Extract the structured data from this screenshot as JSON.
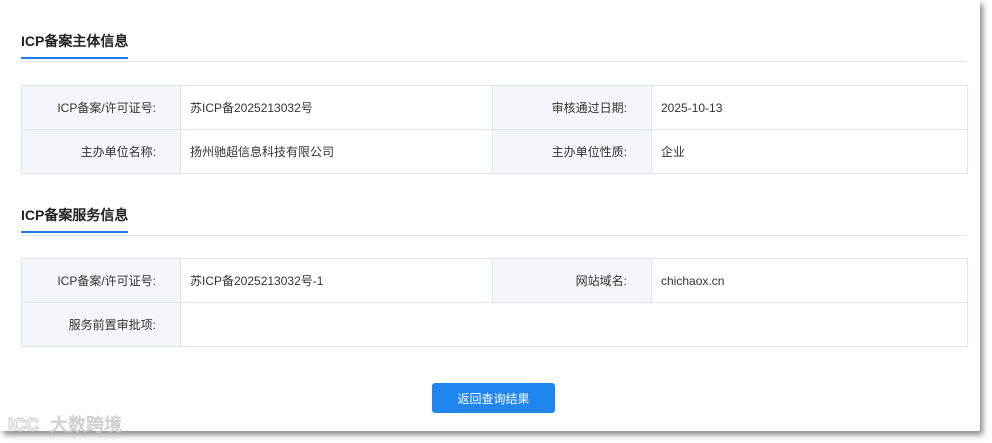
{
  "subject_section": {
    "title": "ICP备案主体信息",
    "rows": [
      {
        "label1": "ICP备案/许可证号:",
        "value1": "苏ICP备2025213032号",
        "label2": "审核通过日期:",
        "value2": "2025-10-13"
      },
      {
        "label1": "主办单位名称:",
        "value1": "扬州驰超信息科技有限公司",
        "label2": "主办单位性质:",
        "value2": "企业"
      }
    ]
  },
  "service_section": {
    "title": "ICP备案服务信息",
    "rows": [
      {
        "label1": "ICP备案/许可证号:",
        "value1": "苏ICP备2025213032号-1",
        "label2": "网站域名:",
        "value2": "chichaox.cn"
      },
      {
        "label1": "服务前置审批项:",
        "value1": ""
      }
    ]
  },
  "actions": {
    "back_label": "返回查询结果"
  },
  "watermark": {
    "text": "大数跨境",
    "logo": "ICC-logo-icon"
  },
  "colors": {
    "accent": "#1f86f0",
    "label_bg": "#f3f7fb",
    "border": "#dde6ef"
  }
}
